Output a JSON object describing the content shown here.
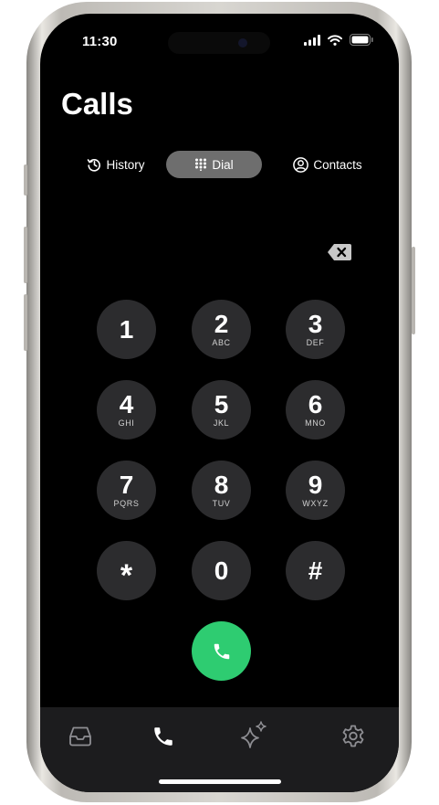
{
  "status_bar": {
    "time": "11:30"
  },
  "page": {
    "title": "Calls"
  },
  "segments": [
    {
      "label": "History",
      "icon": "history-icon",
      "active": false
    },
    {
      "label": "Dial",
      "icon": "keypad-icon",
      "active": true
    },
    {
      "label": "Contacts",
      "icon": "person-circle-icon",
      "active": false
    }
  ],
  "dialpad": {
    "keys": [
      {
        "digit": "1",
        "letters": ""
      },
      {
        "digit": "2",
        "letters": "ABC"
      },
      {
        "digit": "3",
        "letters": "DEF"
      },
      {
        "digit": "4",
        "letters": "GHI"
      },
      {
        "digit": "5",
        "letters": "JKL"
      },
      {
        "digit": "6",
        "letters": "MNO"
      },
      {
        "digit": "7",
        "letters": "PQRS"
      },
      {
        "digit": "8",
        "letters": "TUV"
      },
      {
        "digit": "9",
        "letters": "WXYZ"
      },
      {
        "digit": "*",
        "letters": ""
      },
      {
        "digit": "0",
        "letters": ""
      },
      {
        "digit": "#",
        "letters": ""
      }
    ]
  },
  "tab_bar": {
    "tabs": [
      {
        "icon": "inbox-icon",
        "active": false
      },
      {
        "icon": "phone-icon",
        "active": true
      },
      {
        "icon": "sparkles-icon",
        "active": false
      },
      {
        "icon": "settings-gear-icon",
        "active": false
      }
    ]
  },
  "colors": {
    "call_button": "#2ecc71",
    "active_segment": "#6e6e6e",
    "key_background": "#2c2c2e",
    "tab_bar": "#1c1c1e"
  }
}
